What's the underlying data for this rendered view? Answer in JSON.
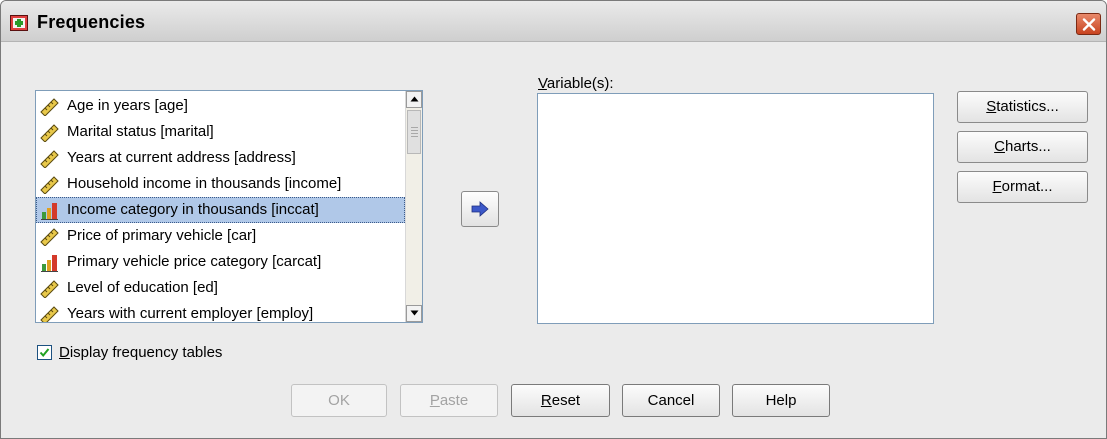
{
  "window": {
    "title": "Frequencies"
  },
  "source_list": {
    "items": [
      {
        "label": "Age in years [age]",
        "type": "scale",
        "selected": false
      },
      {
        "label": "Marital status [marital]",
        "type": "scale",
        "selected": false
      },
      {
        "label": "Years at current address [address]",
        "type": "scale",
        "selected": false
      },
      {
        "label": "Household income in thousands [income]",
        "type": "scale",
        "selected": false
      },
      {
        "label": "Income category in thousands [inccat]",
        "type": "ordinal",
        "selected": true
      },
      {
        "label": "Price of primary vehicle [car]",
        "type": "scale",
        "selected": false
      },
      {
        "label": "Primary vehicle price category [carcat]",
        "type": "ordinal",
        "selected": false
      },
      {
        "label": "Level of education [ed]",
        "type": "scale",
        "selected": false
      },
      {
        "label": "Years with current employer [employ]",
        "type": "scale",
        "selected": false
      }
    ]
  },
  "target": {
    "label_mnemonic": "V",
    "label_rest": "ariable(s):"
  },
  "side_buttons": {
    "statistics": {
      "mnemonic": "S",
      "rest": "tatistics..."
    },
    "charts": {
      "mnemonic": "C",
      "rest": "harts..."
    },
    "format": {
      "mnemonic": "F",
      "rest": "ormat..."
    }
  },
  "checkbox": {
    "mnemonic": "D",
    "rest": "isplay frequency tables",
    "checked": true
  },
  "buttons": {
    "ok": "OK",
    "paste": {
      "mnemonic": "P",
      "rest": "aste"
    },
    "reset": {
      "mnemonic": "R",
      "rest": "eset"
    },
    "cancel": "Cancel",
    "help": "Help"
  },
  "colors": {
    "selection": "#b0c8e8",
    "arrow": "#3c58c8",
    "close": "#c8431f"
  }
}
